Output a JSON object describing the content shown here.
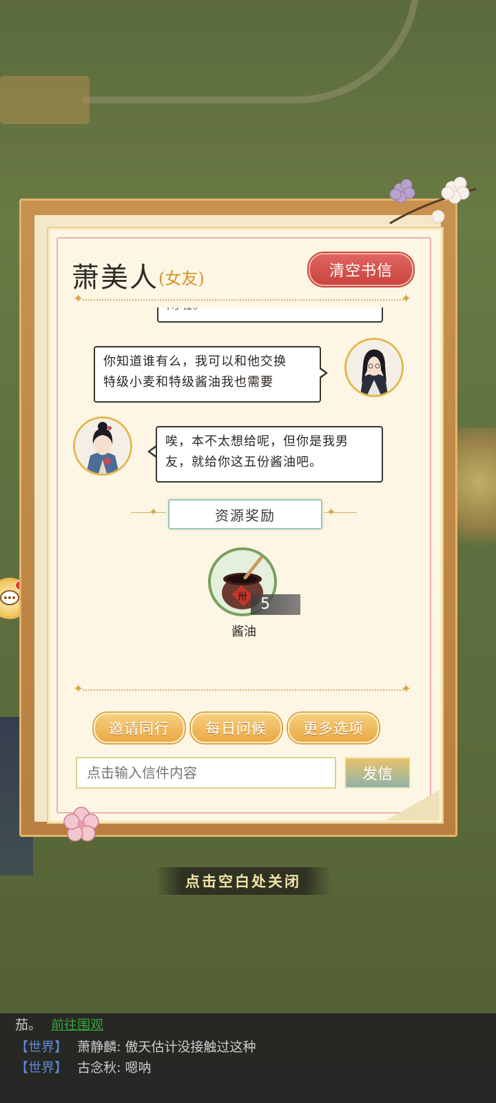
{
  "letter": {
    "sender_name": "萧美人",
    "sender_relation": "(女友)",
    "clear_button": "清空书信"
  },
  "messages": [
    {
      "side": "partial",
      "text": "闲啦。"
    },
    {
      "side": "right",
      "line1": "你知道谁有么，我可以和他交换",
      "line2": "特级小麦和特级酱油我也需要"
    },
    {
      "side": "left",
      "line1": "唉，本不太想给呢，但你是我男",
      "line2": "友，就给你这五份酱油吧。"
    }
  ],
  "reward": {
    "section_label": "资源奖励",
    "item_name": "酱油",
    "item_count": "5",
    "jar_label": "卅"
  },
  "actions": {
    "invite": "邀请同行",
    "daily": "每日问候",
    "more": "更多选项"
  },
  "compose": {
    "placeholder": "点击输入信件内容",
    "send": "发信"
  },
  "close_hint": "点击空白处关闭",
  "world_chat": [
    {
      "prefix": "茄。",
      "link": "前往围观"
    },
    {
      "tag": "【世界】",
      "speaker": "萧静麟:",
      "text": "傲天估计没接触过这种"
    },
    {
      "tag": "【世界】",
      "speaker": "古念秋:",
      "text": "嗯呐"
    }
  ],
  "colors": {
    "accent_red": "#c9443f",
    "accent_gold": "#eaa945",
    "relation_color": "#d3952b",
    "world_tag": "#5b88d6",
    "link_green": "#36a33a"
  },
  "icons": {
    "side_button": "chat-bubble-icon",
    "reward": "soy-sauce-jar-icon"
  }
}
